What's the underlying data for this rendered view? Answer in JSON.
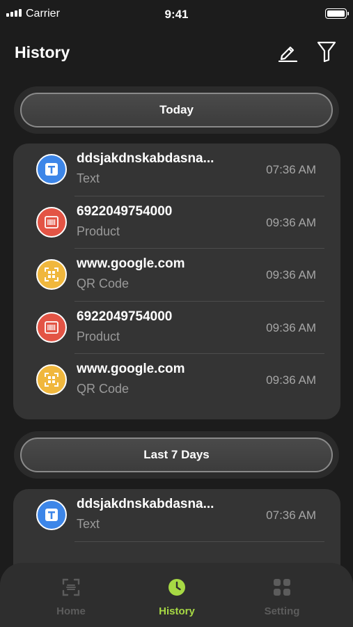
{
  "status_bar": {
    "carrier": "Carrier",
    "time": "9:41"
  },
  "header": {
    "title": "History",
    "edit_icon": "pencil-icon",
    "filter_icon": "filter-icon"
  },
  "colors": {
    "accent": "#a7d944",
    "text_type": "#3d86e8",
    "product_type": "#e35445",
    "qr_type": "#f0b73d"
  },
  "sections": [
    {
      "label": "Today",
      "items": [
        {
          "title": "ddsjakdnskabdasna...",
          "type": "Text",
          "time": "07:36 AM",
          "icon": "text-icon"
        },
        {
          "title": "6922049754000",
          "type": "Product",
          "time": "09:36 AM",
          "icon": "barcode-icon"
        },
        {
          "title": "www.google.com",
          "type": "QR Code",
          "time": "09:36 AM",
          "icon": "qr-code-icon"
        },
        {
          "title": "6922049754000",
          "type": "Product",
          "time": "09:36 AM",
          "icon": "barcode-icon"
        },
        {
          "title": "www.google.com",
          "type": "QR Code",
          "time": "09:36 AM",
          "icon": "qr-code-icon"
        }
      ]
    },
    {
      "label": "Last 7 Days",
      "items": [
        {
          "title": "ddsjakdnskabdasna...",
          "type": "Text",
          "time": "07:36 AM",
          "icon": "text-icon"
        }
      ]
    }
  ],
  "tab_bar": {
    "tabs": [
      {
        "label": "Home",
        "icon": "scan-icon"
      },
      {
        "label": "History",
        "icon": "clock-icon",
        "active": true
      },
      {
        "label": "Setting",
        "icon": "grid-icon"
      }
    ]
  }
}
